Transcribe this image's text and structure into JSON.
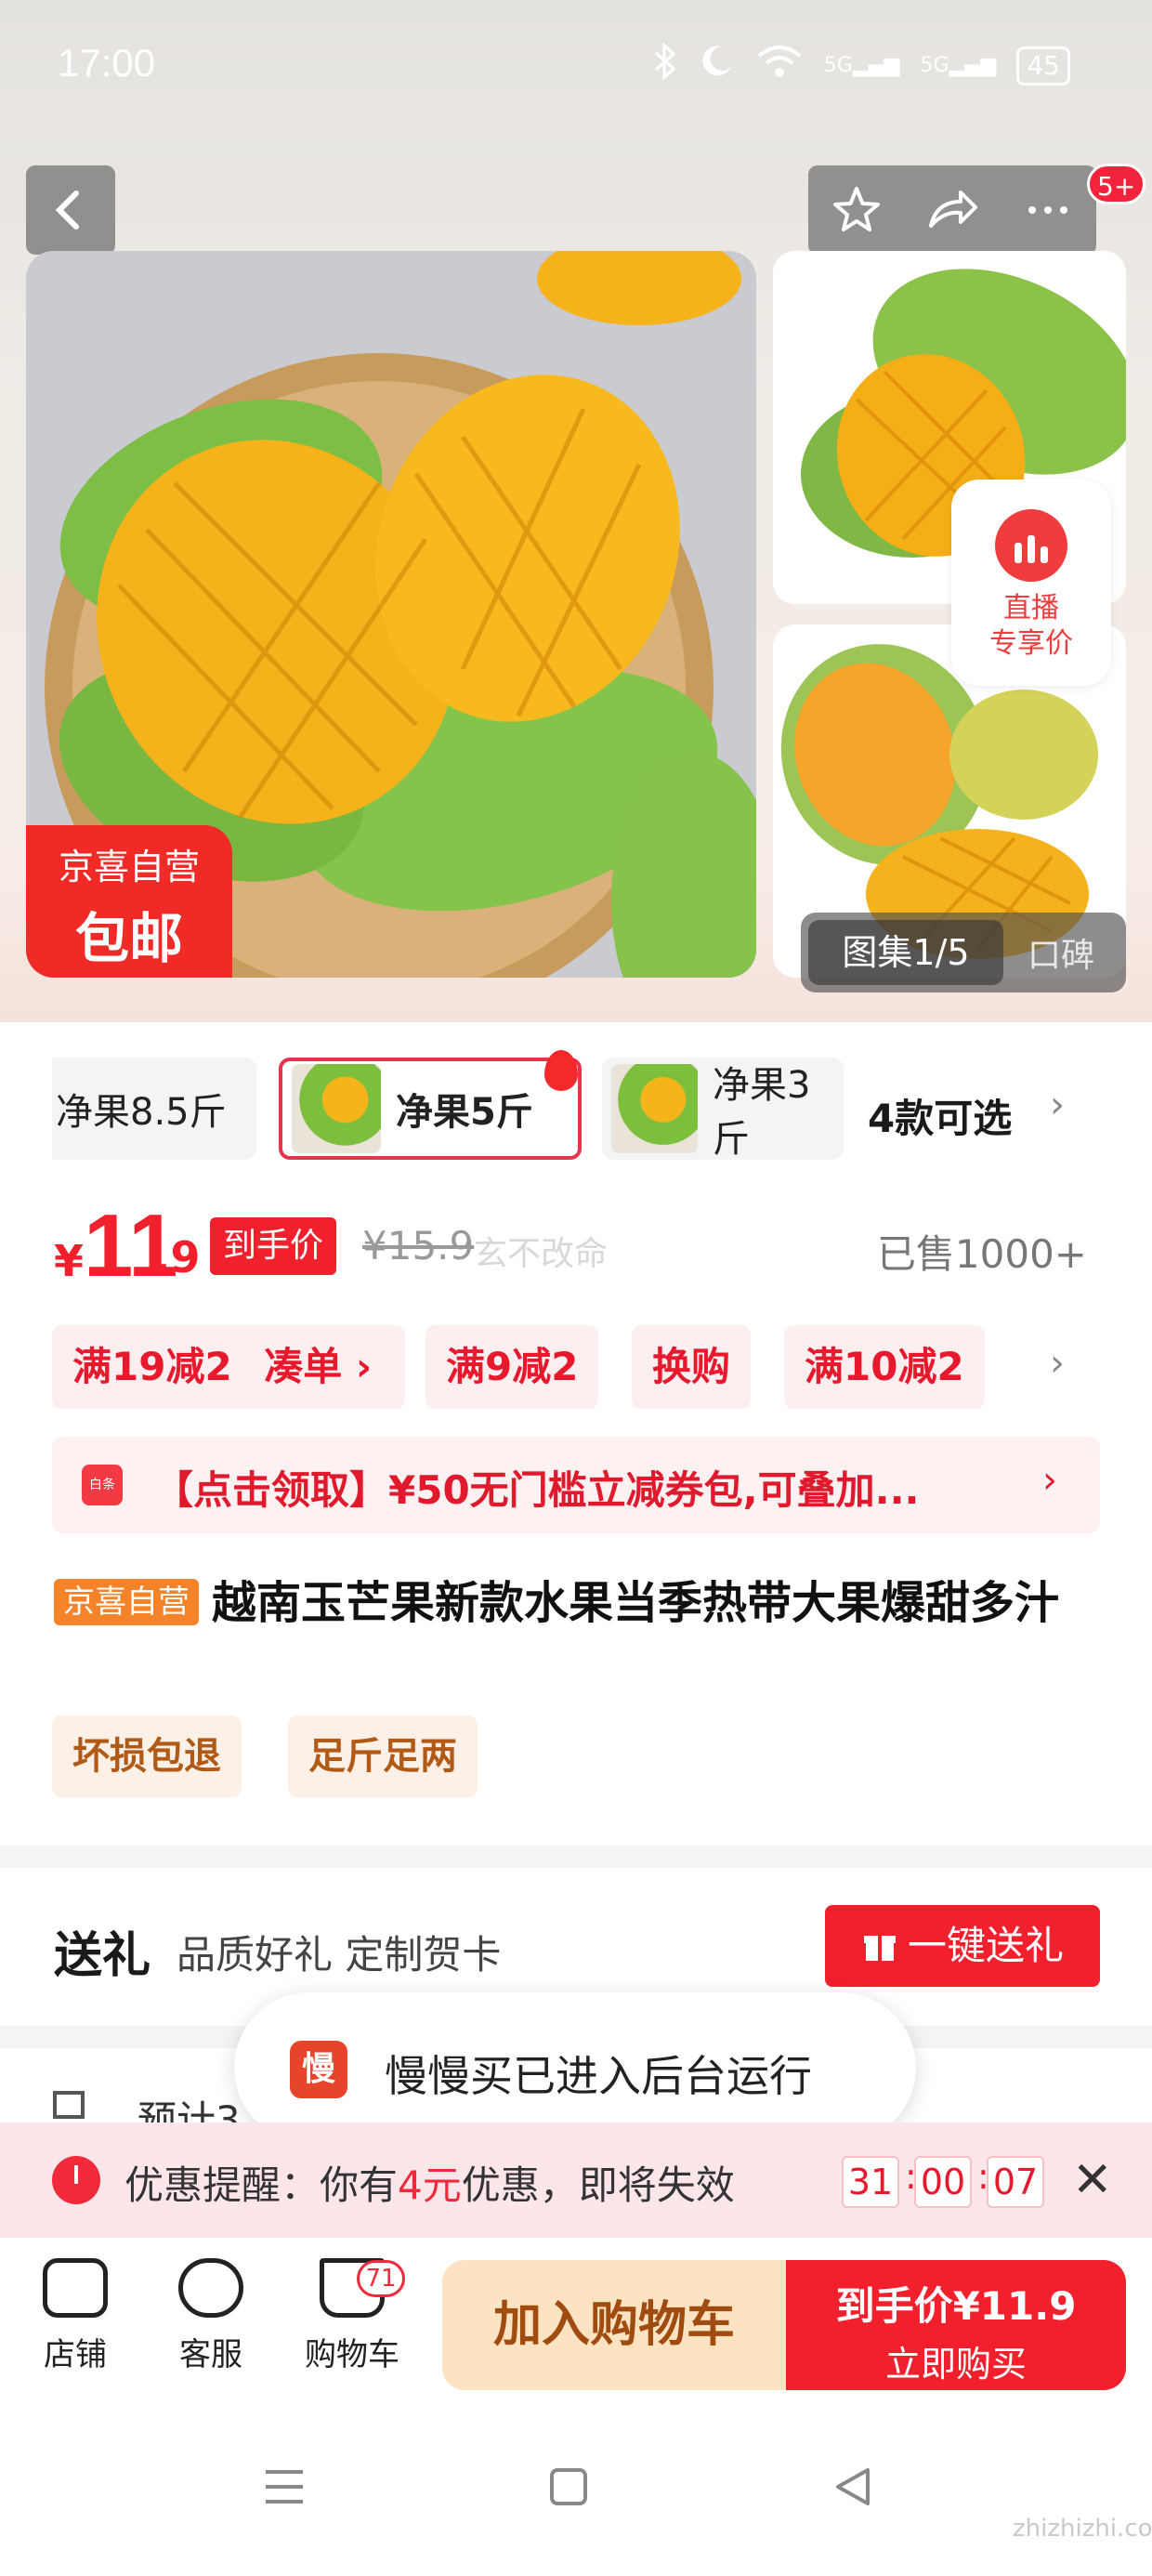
{
  "status_bar": {
    "time": "17:00",
    "network1": "5G",
    "network2": "5G",
    "battery": "45"
  },
  "nav": {
    "badge": "5+"
  },
  "hero": {
    "ship_tag_line1": "京喜自营",
    "ship_tag_line2": "包邮",
    "live_line1": "直播",
    "live_line2": "专享价",
    "gallery_label": "图集1/5",
    "reviews_label": "口碑"
  },
  "sku": {
    "options": [
      "净果8.5斤",
      "净果5斤",
      "净果3斤"
    ],
    "selected_index": 1,
    "count_label": "4款可选"
  },
  "price": {
    "symbol": "¥",
    "integer": "11",
    "decimal": ".9",
    "tag": "到手价",
    "original": "¥15.9",
    "watermark": "玄不改命",
    "sold": "已售1000+"
  },
  "coupons": [
    "满19减2",
    "凑单 ›",
    "满9减2",
    "换购",
    "满10减2"
  ],
  "voucher": {
    "icon": "白条",
    "text": "【点击领取】¥50无门槛立减券包,可叠加..."
  },
  "product": {
    "brand": "京喜自营",
    "title": "越南玉芒果新款水果当季热带大果爆甜多汁"
  },
  "services": [
    "坏损包退",
    "足斤足两"
  ],
  "gift": {
    "title": "送礼",
    "subtitle": "品质好礼 定制贺卡",
    "button": "一键送礼"
  },
  "estimate": {
    "text": "预计3..."
  },
  "toast": {
    "icon": "慢",
    "text": "慢慢买已进入后台运行"
  },
  "promo": {
    "prefix": "优惠提醒：你有",
    "amount": "4元",
    "suffix": "优惠，即将失效",
    "timer": [
      "31",
      "00",
      "07"
    ]
  },
  "bottom_bar": {
    "shop": "店铺",
    "service": "客服",
    "cart": "购物车",
    "cart_badge": "71",
    "add_to_cart": "加入购物车",
    "buy_price": "到手价¥11.9",
    "buy_now": "立即购买"
  },
  "watermark": "zhizhizhi.com",
  "colors": {
    "accent": "#f2202c",
    "brand_orange": "#f5832a",
    "cart_bg": "#fde3c2"
  }
}
